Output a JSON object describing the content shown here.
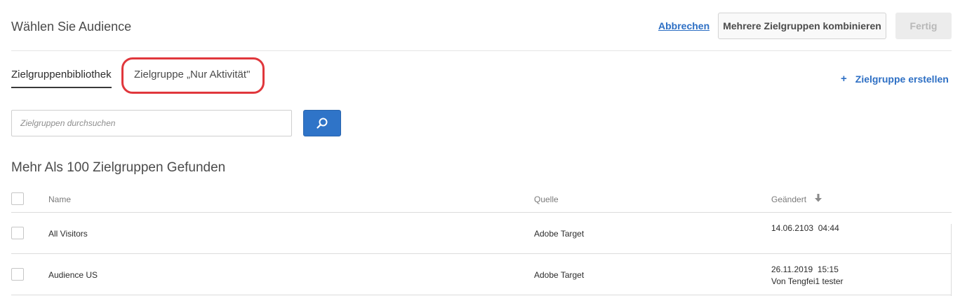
{
  "header": {
    "title": "Wählen Sie Audience",
    "cancel_label": "Abbrechen",
    "combine_label": "Mehrere Zielgruppen kombinieren",
    "done_label": "Fertig"
  },
  "tabs": [
    {
      "label": "Zielgruppenbibliothek",
      "active": true
    },
    {
      "label": "Zielgruppe „Nur Aktivität\"",
      "active": false
    }
  ],
  "create_audience_label": "Zielgruppe erstellen",
  "search": {
    "placeholder": "Zielgruppen durchsuchen",
    "value": ""
  },
  "result_count": "Mehr Als 100 Zielgruppen Gefunden",
  "table": {
    "columns": {
      "name": "Name",
      "source": "Quelle",
      "modified": "Geändert"
    },
    "rows": [
      {
        "name": "All Visitors",
        "source": "Adobe Target",
        "modified": "14.06.2103  04:44",
        "modified_by": ""
      },
      {
        "name": "Audience US",
        "source": "Adobe Target",
        "modified": "26.11.2019  15:15",
        "modified_by": "Von Tengfei1 tester"
      }
    ]
  },
  "colors": {
    "accent": "#2f74c8",
    "link": "#2d6fc4",
    "highlight": "#e0373c"
  }
}
